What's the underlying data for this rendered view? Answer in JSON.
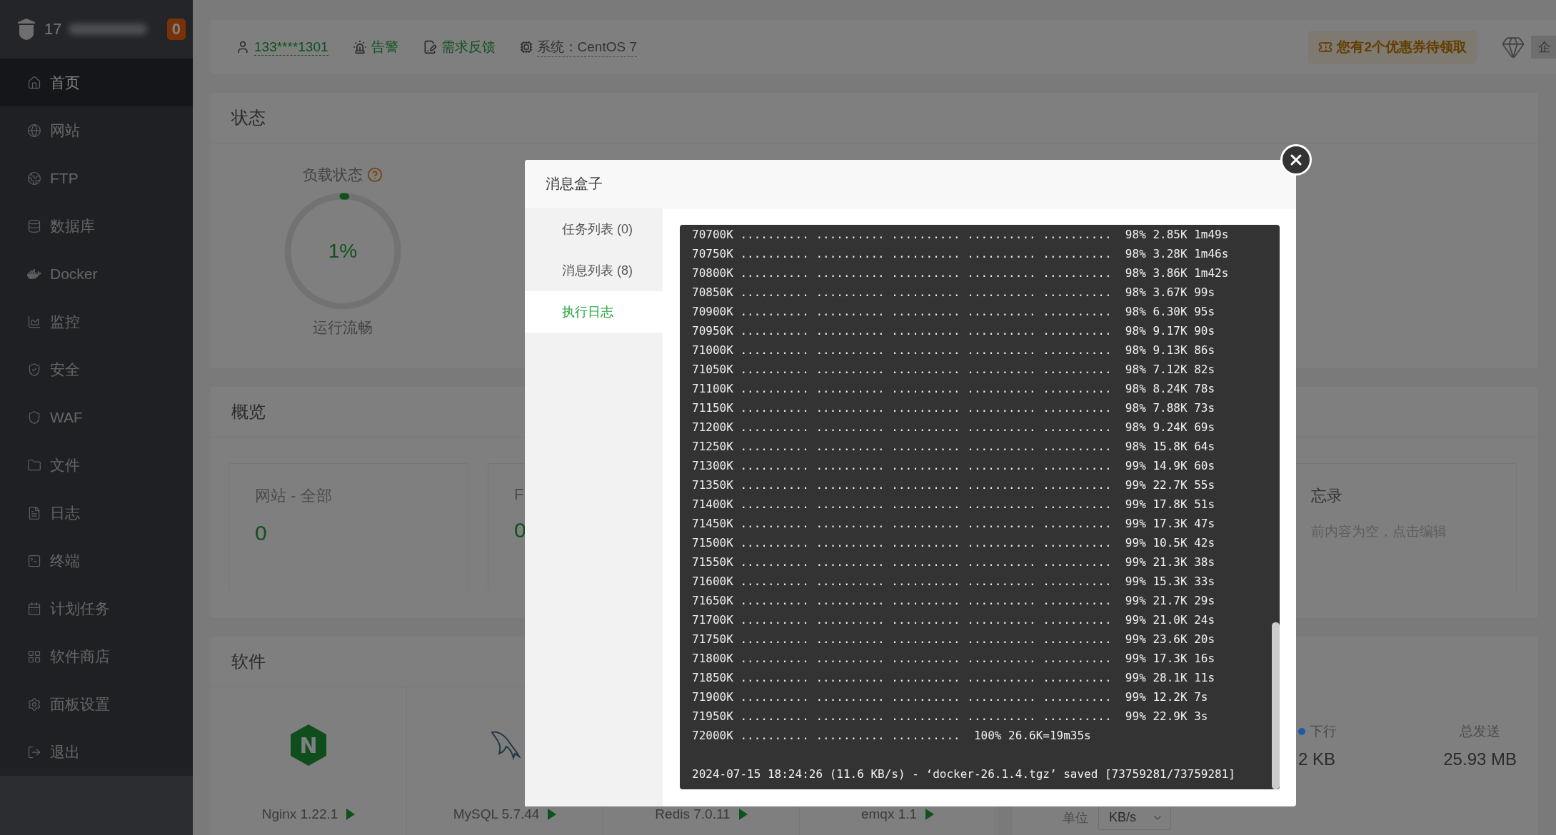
{
  "sidebar": {
    "brand": "17",
    "badge": "0",
    "items": [
      {
        "kind": "home",
        "label": "首页",
        "selected": true
      },
      {
        "kind": "globe",
        "label": "网站",
        "selected": false
      },
      {
        "kind": "ftp",
        "label": "FTP",
        "selected": false
      },
      {
        "kind": "database",
        "label": "数据库",
        "selected": false
      },
      {
        "kind": "docker",
        "label": "Docker",
        "selected": false
      },
      {
        "kind": "monitor",
        "label": "监控",
        "selected": false
      },
      {
        "kind": "security",
        "label": "安全",
        "selected": false
      },
      {
        "kind": "waf",
        "label": "WAF",
        "selected": false
      },
      {
        "kind": "files",
        "label": "文件",
        "selected": false
      },
      {
        "kind": "logs",
        "label": "日志",
        "selected": false
      },
      {
        "kind": "terminal",
        "label": "终端",
        "selected": false
      },
      {
        "kind": "cron",
        "label": "计划任务",
        "selected": false
      },
      {
        "kind": "store",
        "label": "软件商店",
        "selected": false
      },
      {
        "kind": "settings",
        "label": "面板设置",
        "selected": false
      },
      {
        "kind": "logout",
        "label": "退出",
        "selected": false
      }
    ]
  },
  "header": {
    "account": "133****1301",
    "alert": "告警",
    "feedback": "需求反馈",
    "system": "系统：CentOS 7",
    "coupon": "您有2个优惠券待领取",
    "edition": "企"
  },
  "status": {
    "title": "状态",
    "load": {
      "label": "负载状态",
      "level": 0.01,
      "value": "1%",
      "caption": "运行流畅"
    }
  },
  "overview": {
    "title": "概览",
    "cards": [
      {
        "label": "网站 - 全部",
        "value": "0"
      },
      {
        "label": "F",
        "value": "0"
      }
    ],
    "memo": {
      "title": "忘录",
      "hint": "前内容为空，点击编辑"
    }
  },
  "software": {
    "title": "软件",
    "items": [
      {
        "kind": "nginx",
        "logo": "N",
        "name": "Nginx 1.22.1"
      },
      {
        "kind": "mysql",
        "name": "MySQL 5.7.44"
      },
      {
        "kind": "redis",
        "name": "Redis 7.0.11"
      },
      {
        "kind": "emqx",
        "name": "emqx 1.1"
      }
    ]
  },
  "network": {
    "stats": [
      {
        "label": "下行",
        "value": "2 KB",
        "color": "#1c5aa8"
      },
      {
        "label": "总发送",
        "value": "25.93 MB"
      }
    ],
    "unit_label": "单位",
    "unit": "KB/s"
  },
  "modal": {
    "title": "消息盒子",
    "tabs": [
      {
        "label": "任务列表 (0)",
        "selected": false
      },
      {
        "label": "消息列表 (8)",
        "selected": false
      },
      {
        "label": "执行日志",
        "selected": true
      }
    ],
    "log": {
      "lines": [
        "70700K .......... .......... .......... .......... ..........  98% 2.85K 1m49s",
        "70750K .......... .......... .......... .......... ..........  98% 3.28K 1m46s",
        "70800K .......... .......... .......... .......... ..........  98% 3.86K 1m42s",
        "70850K .......... .......... .......... .......... ..........  98% 3.67K 99s",
        "70900K .......... .......... .......... .......... ..........  98% 6.30K 95s",
        "70950K .......... .......... .......... .......... ..........  98% 9.17K 90s",
        "71000K .......... .......... .......... .......... ..........  98% 9.13K 86s",
        "71050K .......... .......... .......... .......... ..........  98% 7.12K 82s",
        "71100K .......... .......... .......... .......... ..........  98% 8.24K 78s",
        "71150K .......... .......... .......... .......... ..........  98% 7.88K 73s",
        "71200K .......... .......... .......... .......... ..........  98% 9.24K 69s",
        "71250K .......... .......... .......... .......... ..........  98% 15.8K 64s",
        "71300K .......... .......... .......... .......... ..........  99% 14.9K 60s",
        "71350K .......... .......... .......... .......... ..........  99% 22.7K 55s",
        "71400K .......... .......... .......... .......... ..........  99% 17.8K 51s",
        "71450K .......... .......... .......... .......... ..........  99% 17.3K 47s",
        "71500K .......... .......... .......... .......... ..........  99% 10.5K 42s",
        "71550K .......... .......... .......... .......... ..........  99% 21.3K 38s",
        "71600K .......... .......... .......... .......... ..........  99% 15.3K 33s",
        "71650K .......... .......... .......... .......... ..........  99% 21.7K 29s",
        "71700K .......... .......... .......... .......... ..........  99% 21.0K 24s",
        "71750K .......... .......... .......... .......... ..........  99% 23.6K 20s",
        "71800K .......... .......... .......... .......... ..........  99% 17.3K 16s",
        "71850K .......... .......... .......... .......... ..........  99% 28.1K 11s",
        "71900K .......... .......... .......... .......... ..........  99% 12.2K 7s",
        "71950K .......... .......... .......... .......... ..........  99% 22.9K 3s",
        "72000K .......... .......... ..........  100% 26.6K=19m35s"
      ],
      "summary": "2024-07-15 18:24:26 (11.6 KB/s) - ‘docker-26.1.4.tgz’ saved [73759281/73759281]"
    }
  }
}
